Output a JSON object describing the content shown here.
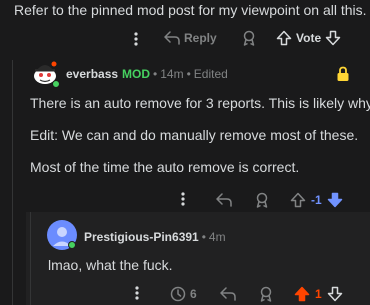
{
  "top_comment": {
    "text": "Refer to the pinned mod post for my viewpoint on all this.",
    "actions": {
      "reply_label": "Reply",
      "vote_label": "Vote"
    }
  },
  "mod_comment": {
    "username": "everbass",
    "badge": "MOD",
    "separator": "•",
    "time": "14m",
    "edited": "Edited",
    "paragraphs": [
      "There is an auto remove for 3 reports. This is likely why.",
      "Edit: We can and do manually remove most of these.",
      "Most of the time the auto remove is correct."
    ],
    "vote_score": "-1",
    "colors": {
      "mod": "#46d160",
      "lock": "#ffd635",
      "downvoted": "#7193ff"
    }
  },
  "reply_comment": {
    "username": "Prestigious-Pin6391",
    "separator": "•",
    "time": "4m",
    "text": "lmao, what the fuck.",
    "award_count": "6",
    "vote_score": "1",
    "colors": {
      "upvoted": "#ff4500"
    }
  }
}
